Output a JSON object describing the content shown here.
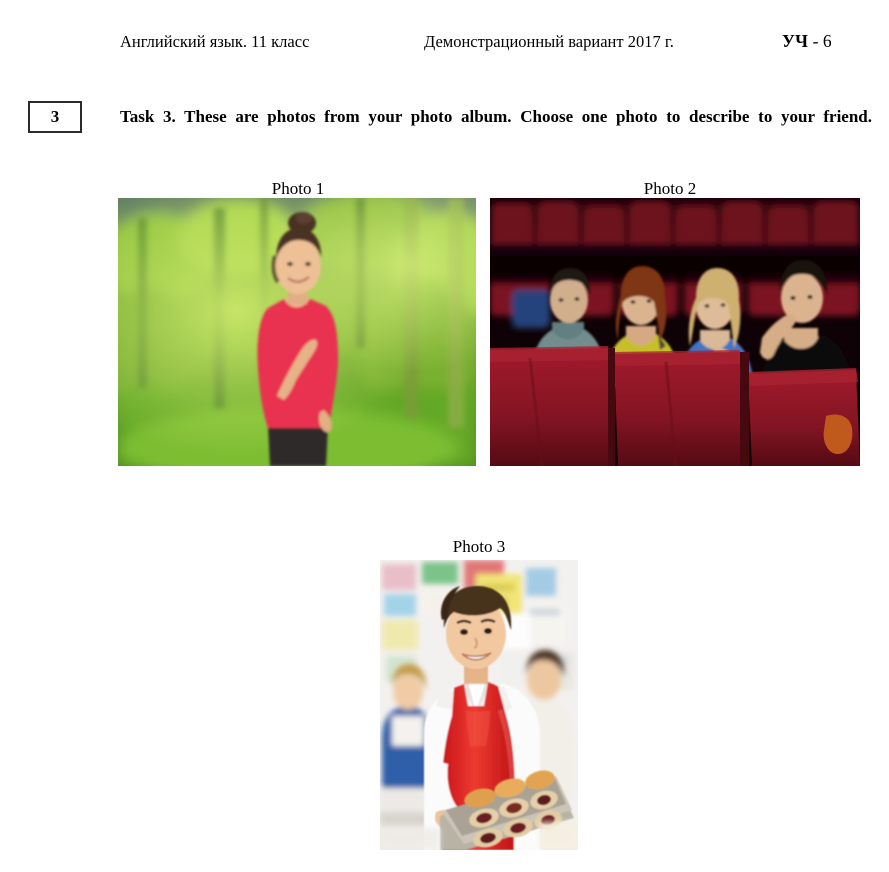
{
  "header": {
    "subject": "Английский язык. 11 класс",
    "variant": "Демонстрационный вариант 2017 г.",
    "code": "УЧ",
    "code_separator": " - 6"
  },
  "task": {
    "number": "3",
    "text": "Task 3. These are photos from your photo album. Choose one photo to describe to your friend."
  },
  "photos": [
    {
      "caption": "Photo 1",
      "alt": "A smiling young woman with hair in a bun, wearing a red short-sleeved top and dark trousers, standing in a sunlit green park with blurred trees behind her.",
      "colors": {
        "top": "#e8304f",
        "trousers": "#2e2a2a",
        "skin": "#e8b98f",
        "hair": "#4a3224",
        "foliage_light": "#9ccf3a",
        "foliage_dark": "#3c7a1e",
        "grass": "#7cbb2e",
        "sky": "#6f8c74"
      }
    },
    {
      "caption": "Photo 2",
      "alt": "Four young people sitting in a row of red cinema seats in a dark auditorium, watching a film.",
      "colors": {
        "seats": "#9e1728",
        "seats_dark": "#5e0d18",
        "background": "#120308",
        "person1_top": "#7d9a9b",
        "person2_top": "#d8d02f",
        "person3_top": "#4a7fd4",
        "person4_top": "#111111",
        "glove": "#d0621f",
        "blue_seat": "#2a4d8f"
      }
    },
    {
      "caption": "Photo 3",
      "alt": "A smiling teenage boy in a white shirt and red apron holding a baking tray full of muffins and jam tarts in a school classroom.",
      "colors": {
        "apron": "#e52421",
        "shirt": "#fbfbfb",
        "hair": "#46301d",
        "skin": "#f0c49c",
        "tray": "#b9b3a6",
        "muffin": "#dfa04d",
        "jam": "#6d1b20",
        "wall": "#f2f0ee",
        "poster_yellow": "#f2e46a",
        "poster_blue": "#9bc7e4",
        "poster_red": "#e06a6a",
        "poster_green": "#6fbf7f"
      }
    }
  ]
}
